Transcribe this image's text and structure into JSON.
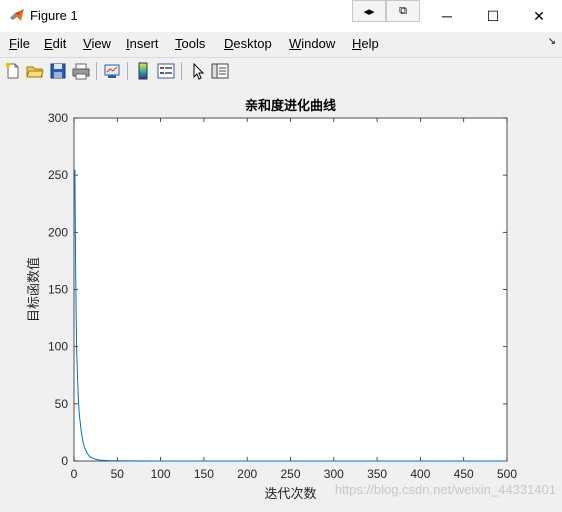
{
  "window": {
    "title": "Figure 1",
    "controls": {
      "minimize": "─",
      "maximize": "☐",
      "close": "✕"
    },
    "extra_buttons": [
      "◂▸",
      "⧉"
    ]
  },
  "menu": {
    "items": [
      {
        "label": "File",
        "accel": "F",
        "rest": "ile"
      },
      {
        "label": "Edit",
        "accel": "E",
        "rest": "dit"
      },
      {
        "label": "View",
        "accel": "V",
        "rest": "iew"
      },
      {
        "label": "Insert",
        "accel": "I",
        "rest": "nsert"
      },
      {
        "label": "Tools",
        "accel": "T",
        "rest": "ools"
      },
      {
        "label": "Desktop",
        "accel": "D",
        "rest": "esktop"
      },
      {
        "label": "Window",
        "accel": "W",
        "rest": "indow"
      },
      {
        "label": "Help",
        "accel": "H",
        "rest": "elp"
      }
    ],
    "overflow_arrow": "↘"
  },
  "toolbar": {
    "icons": [
      "new-file-icon",
      "open-folder-icon",
      "save-icon",
      "print-icon",
      "link-plot-icon",
      "colorbar-icon",
      "legend-icon",
      "pointer-icon",
      "property-editor-icon"
    ]
  },
  "watermark": "https://blog.csdn.net/weixin_44331401",
  "colors": {
    "line": "#0072bd",
    "axes_bg": "#ffffff",
    "figure_bg": "#f0f0f0"
  },
  "chart_data": {
    "type": "line",
    "title": "亲和度进化曲线",
    "xlabel": "迭代次数",
    "ylabel": "目标函数值",
    "xlim": [
      0,
      500
    ],
    "ylim": [
      0,
      300
    ],
    "xticks": [
      0,
      50,
      100,
      150,
      200,
      250,
      300,
      350,
      400,
      450,
      500
    ],
    "yticks": [
      0,
      50,
      100,
      150,
      200,
      250,
      300
    ],
    "grid": false,
    "series": [
      {
        "x": [
          1,
          2,
          3,
          4,
          5,
          6,
          8,
          10,
          12,
          15,
          18,
          20,
          25,
          30,
          40,
          60,
          100,
          200,
          300,
          400,
          500
        ],
        "y": [
          255,
          160,
          100,
          75,
          55,
          42,
          28,
          18,
          12,
          7,
          4,
          3,
          1.5,
          0.8,
          0.3,
          0.1,
          0.05,
          0.02,
          0.01,
          0.01,
          0.01
        ]
      }
    ]
  }
}
